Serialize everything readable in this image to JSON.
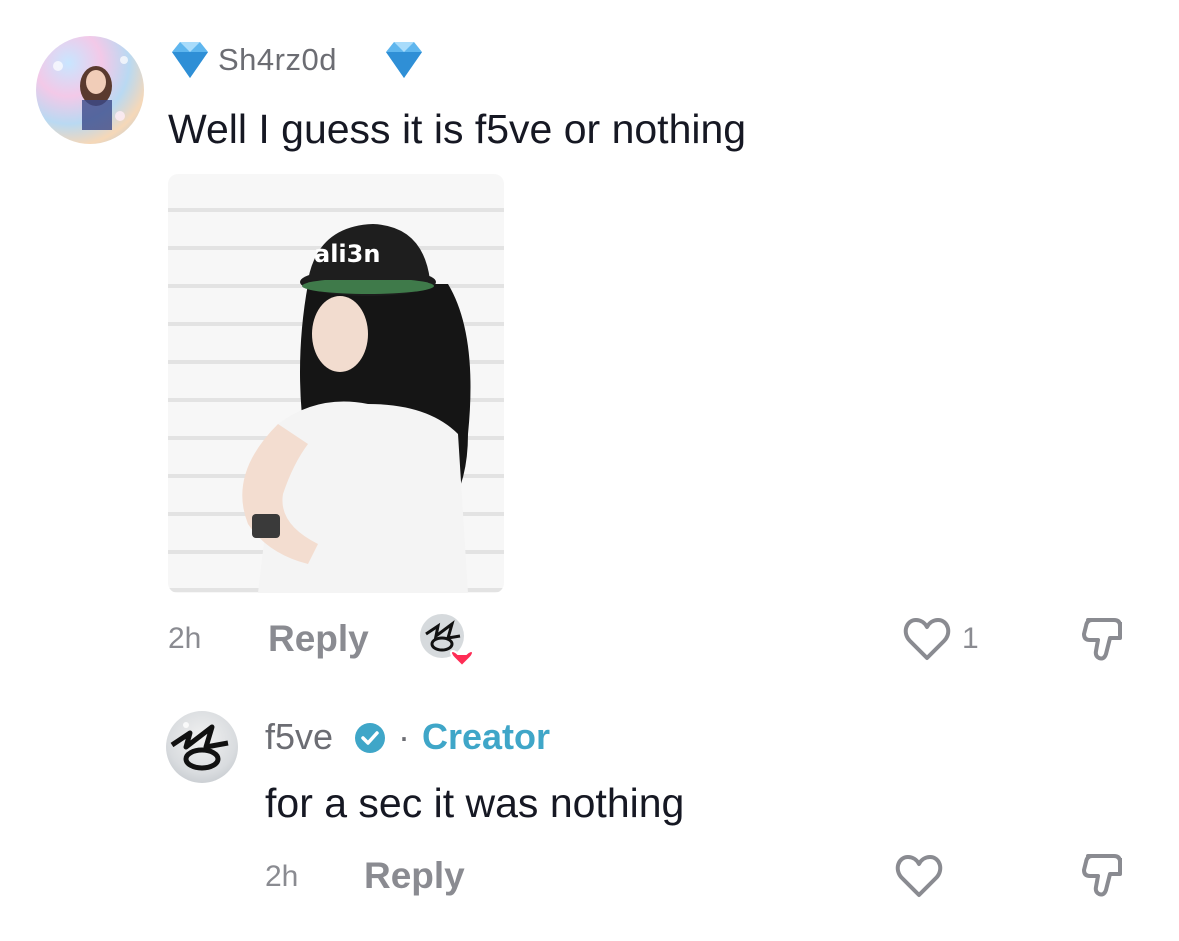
{
  "comment1": {
    "username": "Sh4rz0d",
    "text": "Well I guess it is f5ve or nothing",
    "image_cap_text": "ali3n",
    "time": "2h",
    "reply_label": "Reply",
    "like_count": "1"
  },
  "comment2": {
    "username": "f5ve",
    "separator": "·",
    "badge_label": "Creator",
    "text": "for a sec it was nothing",
    "time": "2h",
    "reply_label": "Reply"
  },
  "colors": {
    "creator_accent": "#3fa6c8",
    "verified_badge": "#3fa6c8",
    "heart_badge": "#fe2c55",
    "diamond": "#5fb6ee",
    "muted_text": "#8a8b91"
  },
  "icons": [
    "diamond-icon",
    "verified-icon",
    "heart-outline-icon",
    "dislike-icon",
    "creator-liked-icon"
  ]
}
